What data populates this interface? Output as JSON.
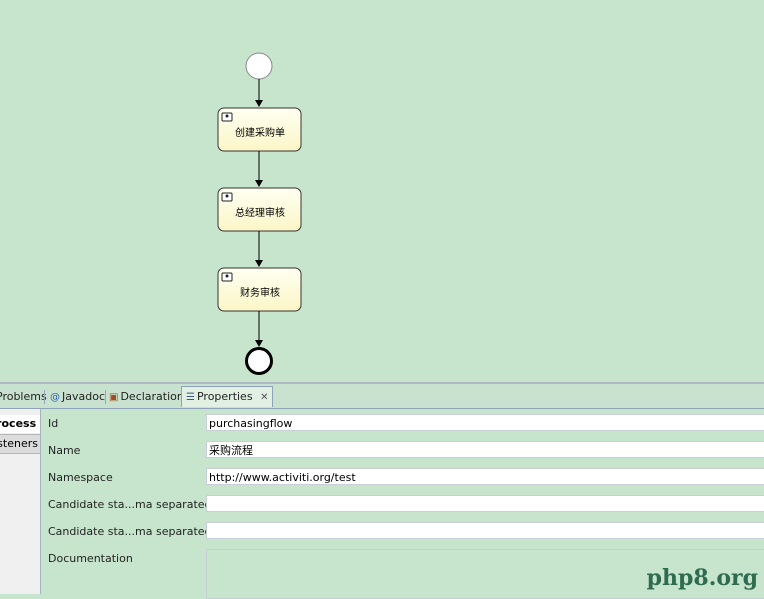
{
  "diagram": {
    "tasks": [
      {
        "label": "创建采购单"
      },
      {
        "label": "总经理审核"
      },
      {
        "label": "财务审核"
      }
    ]
  },
  "tabs": [
    {
      "label": "Problems"
    },
    {
      "label": "Javadoc"
    },
    {
      "label": "Declaration"
    },
    {
      "label": "Properties"
    }
  ],
  "sidebar": {
    "items": [
      {
        "label": "Process"
      },
      {
        "label": "Listeners"
      }
    ]
  },
  "properties": {
    "id": {
      "label": "Id",
      "value": "purchasingflow"
    },
    "name": {
      "label": "Name",
      "value": "采购流程"
    },
    "namespace": {
      "label": "Namespace",
      "value": "http://www.activiti.org/test"
    },
    "candidate_users": {
      "label": "Candidate sta...ma separated)",
      "value": ""
    },
    "candidate_groups": {
      "label": "Candidate sta...ma separated)",
      "value": ""
    },
    "documentation": {
      "label": "Documentation",
      "value": ""
    }
  },
  "watermark": "php8.org"
}
